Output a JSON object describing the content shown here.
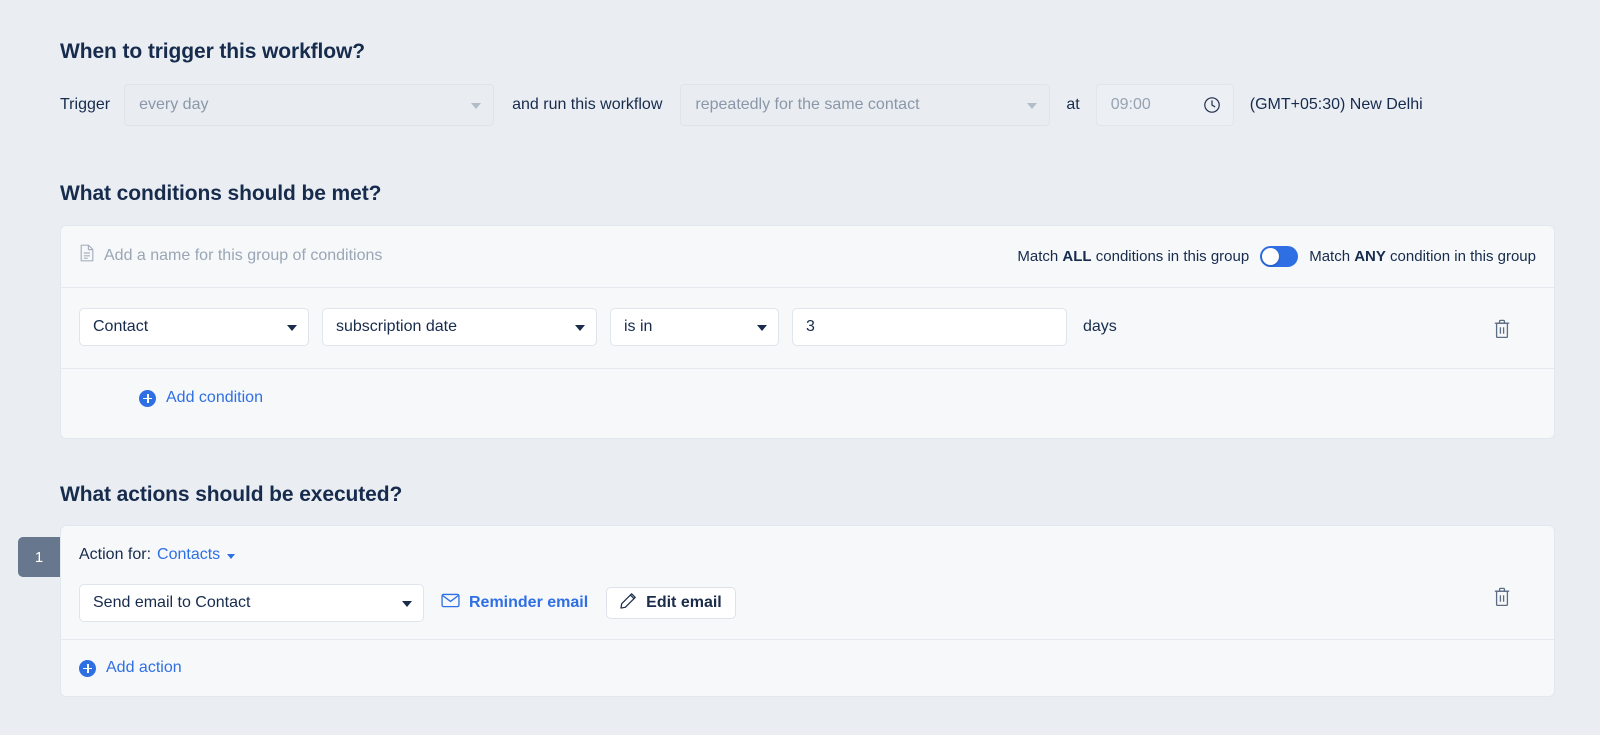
{
  "trigger_section": {
    "title": "When to trigger this workflow?",
    "label_trigger": "Trigger",
    "frequency_value": "every day",
    "label_run": "and run this workflow",
    "repeat_value": "repeatedly for the same contact",
    "label_at": "at",
    "time_value": "09:00",
    "timezone": "(GMT+05:30) New Delhi",
    "icons": {
      "frequency_caret": "chevron-down-icon",
      "repeat_caret": "chevron-down-icon",
      "time": "clock-icon"
    }
  },
  "conditions_section": {
    "title": "What conditions should be met?",
    "group_name_placeholder": "Add a name for this group of conditions",
    "group_name_icon": "document-icon",
    "match_all_prefix": "Match ",
    "match_all_strong": "ALL",
    "match_all_suffix": " conditions in this group",
    "match_any_prefix": "Match ",
    "match_any_strong": "ANY",
    "match_any_suffix": " condition in this group",
    "toggle_state": "any",
    "toggle_color": "#2f6fe4",
    "rows": [
      {
        "object": "Contact",
        "field": "subscription date",
        "operator": "is in",
        "value": "3",
        "unit": "days",
        "delete_icon": "trash-icon"
      }
    ],
    "add_label": "Add condition",
    "add_icon": "plus-circle-icon"
  },
  "actions_section": {
    "title": "What actions should be executed?",
    "steps": [
      {
        "number": "1",
        "action_for_label": "Action for:",
        "action_for_value": "Contacts",
        "action_for_caret": "chevron-down-icon",
        "action_type": "Send email to Contact",
        "email_link": "Reminder email",
        "email_link_icon": "envelope-icon",
        "edit_button": "Edit email",
        "edit_button_icon": "pencil-icon",
        "delete_icon": "trash-icon"
      }
    ],
    "add_label": "Add action",
    "add_icon": "plus-circle-icon"
  },
  "theme": {
    "page_background": "#eaeef3",
    "card_background": "#f6f8fa",
    "accent_blue": "#2f6fe4",
    "text_dark": "#172b4d",
    "badge_slate": "#67778e"
  }
}
